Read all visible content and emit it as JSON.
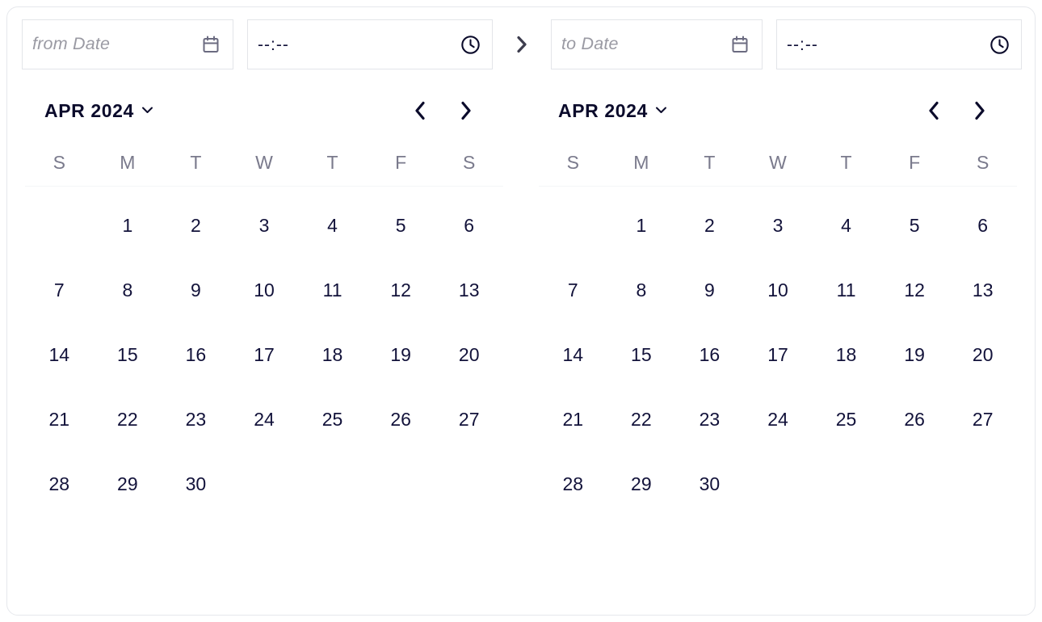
{
  "range_picker": {
    "inputs": {
      "from_date": {
        "name": "from-date-input",
        "value": "",
        "placeholder": "from Date",
        "icon": "calendar-icon"
      },
      "from_time": {
        "name": "from-time-input",
        "value": "--:--",
        "placeholder": "--:--",
        "icon": "clock-icon"
      },
      "separator": {
        "icon": "chevron-right-icon"
      },
      "to_date": {
        "name": "to-date-input",
        "value": "",
        "placeholder": "to Date",
        "icon": "calendar-icon"
      },
      "to_time": {
        "name": "to-time-input",
        "value": "--:--",
        "placeholder": "--:--",
        "icon": "clock-icon"
      }
    },
    "weekdays": [
      "S",
      "M",
      "T",
      "W",
      "T",
      "F",
      "S"
    ],
    "calendars": [
      {
        "id": "start-calendar",
        "title": "APR 2024",
        "title_chevron": "chevron-down-icon",
        "prev_icon": "chevron-left-icon",
        "next_icon": "chevron-right-icon",
        "leading_blanks": 1,
        "days": [
          1,
          2,
          3,
          4,
          5,
          6,
          7,
          8,
          9,
          10,
          11,
          12,
          13,
          14,
          15,
          16,
          17,
          18,
          19,
          20,
          21,
          22,
          23,
          24,
          25,
          26,
          27,
          28,
          29,
          30
        ]
      },
      {
        "id": "end-calendar",
        "title": "APR 2024",
        "title_chevron": "chevron-down-icon",
        "prev_icon": "chevron-left-icon",
        "next_icon": "chevron-right-icon",
        "leading_blanks": 1,
        "days": [
          1,
          2,
          3,
          4,
          5,
          6,
          7,
          8,
          9,
          10,
          11,
          12,
          13,
          14,
          15,
          16,
          17,
          18,
          19,
          20,
          21,
          22,
          23,
          24,
          25,
          26,
          27,
          28,
          29,
          30
        ]
      }
    ],
    "colors": {
      "card_border": "#e6e8ec",
      "field_border": "#e3e5e9",
      "text_dark": "#12123a",
      "title_dark": "#0b0b2b",
      "muted": "#7a7a8c",
      "placeholder": "#9a9aa3"
    }
  }
}
